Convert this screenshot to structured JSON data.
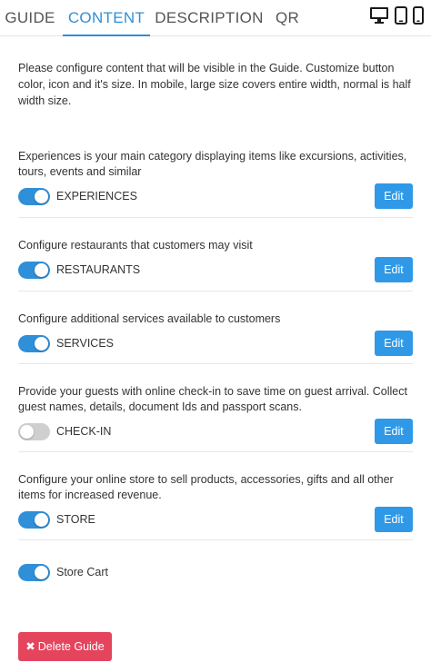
{
  "tabs": [
    {
      "label": "GUIDE"
    },
    {
      "label": "CONTENT",
      "active": true
    },
    {
      "label": "DESCRIPTION"
    },
    {
      "label": "QR"
    }
  ],
  "device_icons": [
    "desktop-icon",
    "tablet-icon",
    "mobile-icon"
  ],
  "intro": "Please configure content that will be visible in the Guide. Customize button color, icon and it's size. In mobile, large size covers entire width, normal is half width size.",
  "sections": [
    {
      "description": "Experiences is your main category displaying items like excursions, activities, tours, events and similar",
      "label": "EXPERIENCES",
      "enabled": true,
      "edit_label": "Edit"
    },
    {
      "description": "Configure restaurants that customers may visit",
      "label": "RESTAURANTS",
      "enabled": true,
      "edit_label": "Edit"
    },
    {
      "description": "Configure additional services available to customers",
      "label": "SERVICES",
      "enabled": true,
      "edit_label": "Edit"
    },
    {
      "description": "Provide your guests with online check-in to save time on guest arrival. Collect guest names, details, document Ids and passport scans.",
      "label": "CHECK-IN",
      "enabled": false,
      "edit_label": "Edit"
    },
    {
      "description": "Configure your online store to sell products, accessories, gifts and all other items for increased revenue.",
      "label": "STORE",
      "enabled": true,
      "edit_label": "Edit"
    }
  ],
  "store_cart": {
    "label": "Store Cart",
    "enabled": true
  },
  "delete_button": {
    "label": "Delete Guide",
    "icon": "close-icon"
  },
  "colors": {
    "accent": "#2f8fd8",
    "edit_button": "#2f99e8",
    "danger": "#e4455d",
    "toggle_off": "#cfcfcf"
  }
}
